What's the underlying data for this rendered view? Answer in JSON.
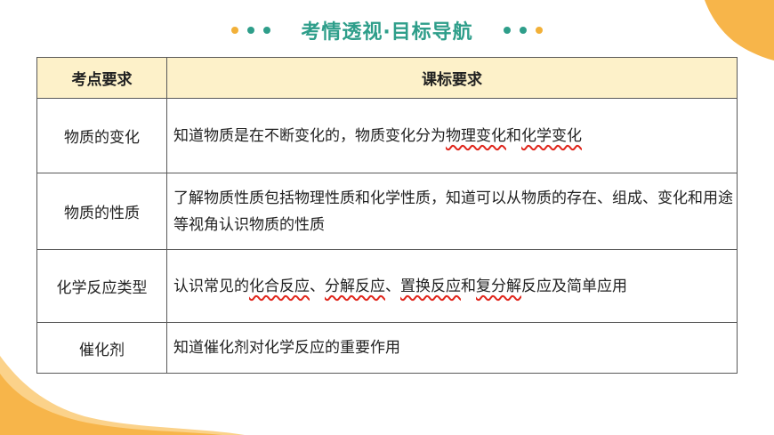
{
  "header": {
    "title": "考情透视·目标导航",
    "left_dot_colors": [
      "#f2b038",
      "#2e9e8a",
      "#2e9e8a"
    ],
    "right_dot_colors": [
      "#2e9e8a",
      "#2e9e8a",
      "#f2b038"
    ]
  },
  "colors": {
    "accent_orange": "#f7b54a",
    "title_teal": "#2e9e8a",
    "header_fill": "#fdf1c9",
    "wavy_underline": "#e0261c"
  },
  "table": {
    "headers": [
      "考点要求",
      "课标要求"
    ],
    "rows": [
      {
        "topic": "物质的变化",
        "req": [
          {
            "t": "知道物质是在不断变化的，物质变化分为",
            "u": false
          },
          {
            "t": "物理变化",
            "u": true
          },
          {
            "t": "和",
            "u": false
          },
          {
            "t": "化学变化",
            "u": true
          }
        ]
      },
      {
        "topic": "物质的性质",
        "req": [
          {
            "t": "了解物质性质包括物理性质和化学性质，知道可以从物质的存在、组成、变化和用途等视角认识物质的性质",
            "u": false
          }
        ]
      },
      {
        "topic": "化学反应类型",
        "req": [
          {
            "t": "认识常见的",
            "u": false
          },
          {
            "t": "化合反应",
            "u": true
          },
          {
            "t": "、",
            "u": false
          },
          {
            "t": "分解反应",
            "u": true
          },
          {
            "t": "、",
            "u": false
          },
          {
            "t": "置换反应",
            "u": true
          },
          {
            "t": "和",
            "u": false
          },
          {
            "t": "复分解",
            "u": true
          },
          {
            "t": "反应及简单应用",
            "u": false
          }
        ]
      },
      {
        "topic": "催化剂",
        "req": [
          {
            "t": "知道催化剂对化学反应的重要作用",
            "u": false
          }
        ]
      }
    ]
  }
}
